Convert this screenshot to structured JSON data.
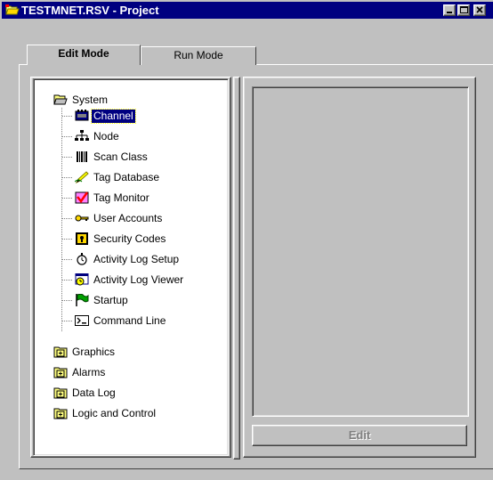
{
  "window": {
    "title": "TESTMNET.RSV - Project",
    "controls": {
      "minimize": "minimize",
      "maximize": "maximize",
      "close": "close"
    }
  },
  "tabs": [
    {
      "label": "Edit Mode",
      "active": true
    },
    {
      "label": "Run Mode",
      "active": false
    }
  ],
  "tree": {
    "root": {
      "label": "System",
      "icon": "open-folder-icon",
      "expanded": true
    },
    "children": [
      {
        "label": "Channel",
        "icon": "channel-icon",
        "selected": true
      },
      {
        "label": "Node",
        "icon": "node-network-icon"
      },
      {
        "label": "Scan Class",
        "icon": "barcode-icon"
      },
      {
        "label": "Tag Database",
        "icon": "pencil-icon"
      },
      {
        "label": "Tag Monitor",
        "icon": "checkmark-monitor-icon"
      },
      {
        "label": "User Accounts",
        "icon": "key-icon"
      },
      {
        "label": "Security Codes",
        "icon": "lock-icon"
      },
      {
        "label": "Activity Log Setup",
        "icon": "stopwatch-icon"
      },
      {
        "label": "Activity Log Viewer",
        "icon": "clock-window-icon"
      },
      {
        "label": "Startup",
        "icon": "green-flag-icon"
      },
      {
        "label": "Command Line",
        "icon": "command-prompt-icon"
      }
    ],
    "folders": [
      {
        "label": "Graphics",
        "icon": "collapsed-folder-icon"
      },
      {
        "label": "Alarms",
        "icon": "collapsed-folder-icon"
      },
      {
        "label": "Data Log",
        "icon": "collapsed-folder-icon"
      },
      {
        "label": "Logic and Control",
        "icon": "collapsed-folder-icon"
      }
    ]
  },
  "detail": {
    "edit_button": "Edit",
    "edit_enabled": false
  },
  "colors": {
    "titlebar": "#000080",
    "face": "#c0c0c0",
    "selection": "#000080"
  }
}
